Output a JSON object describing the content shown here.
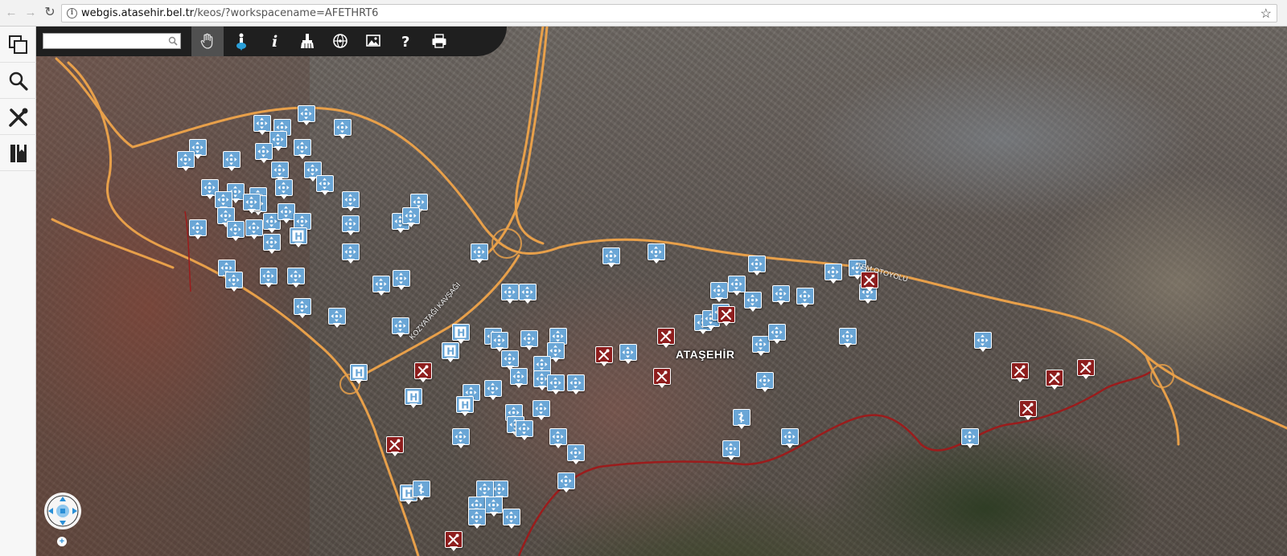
{
  "browser": {
    "url_host": "webgis.atasehir.bel.tr",
    "url_path": "/keos/?workspacename=AFETHRT6",
    "back_icon": "arrow-left-icon",
    "forward_icon": "arrow-right-icon",
    "reload_icon": "reload-icon",
    "bookmark_icon": "star-icon"
  },
  "sidebar": {
    "items": [
      {
        "name": "layers",
        "icon": "layers-icon"
      },
      {
        "name": "search",
        "icon": "magnifier-icon"
      },
      {
        "name": "tools",
        "icon": "tools-icon"
      },
      {
        "name": "legend",
        "icon": "book-icon"
      }
    ]
  },
  "toolbar": {
    "search_value": "",
    "search_placeholder": "",
    "tools": [
      {
        "name": "pan",
        "icon": "hand-icon",
        "active": true
      },
      {
        "name": "locate",
        "icon": "person-marker-icon"
      },
      {
        "name": "info",
        "icon": "info-icon"
      },
      {
        "name": "clear",
        "icon": "brush-icon"
      },
      {
        "name": "full-extent",
        "icon": "globe-icon"
      },
      {
        "name": "image",
        "icon": "image-icon"
      },
      {
        "name": "help",
        "icon": "question-icon"
      },
      {
        "name": "print",
        "icon": "printer-icon"
      }
    ]
  },
  "map": {
    "labels": {
      "district": "ATAŞEHİR",
      "road_kozyatagi": "KOZYATAĞI KAVŞAĞI",
      "road_tem": "TEM OTOYOLU"
    },
    "colors": {
      "highway": "#e8a04a",
      "boundary": "#9b1c1c",
      "assembly_marker": "#6aa6d6",
      "repair_marker": "#8e1e1e"
    },
    "marker_types": [
      "assembly-area",
      "hospital",
      "pharmacy",
      "repair"
    ],
    "zoom_in_label": "+"
  }
}
